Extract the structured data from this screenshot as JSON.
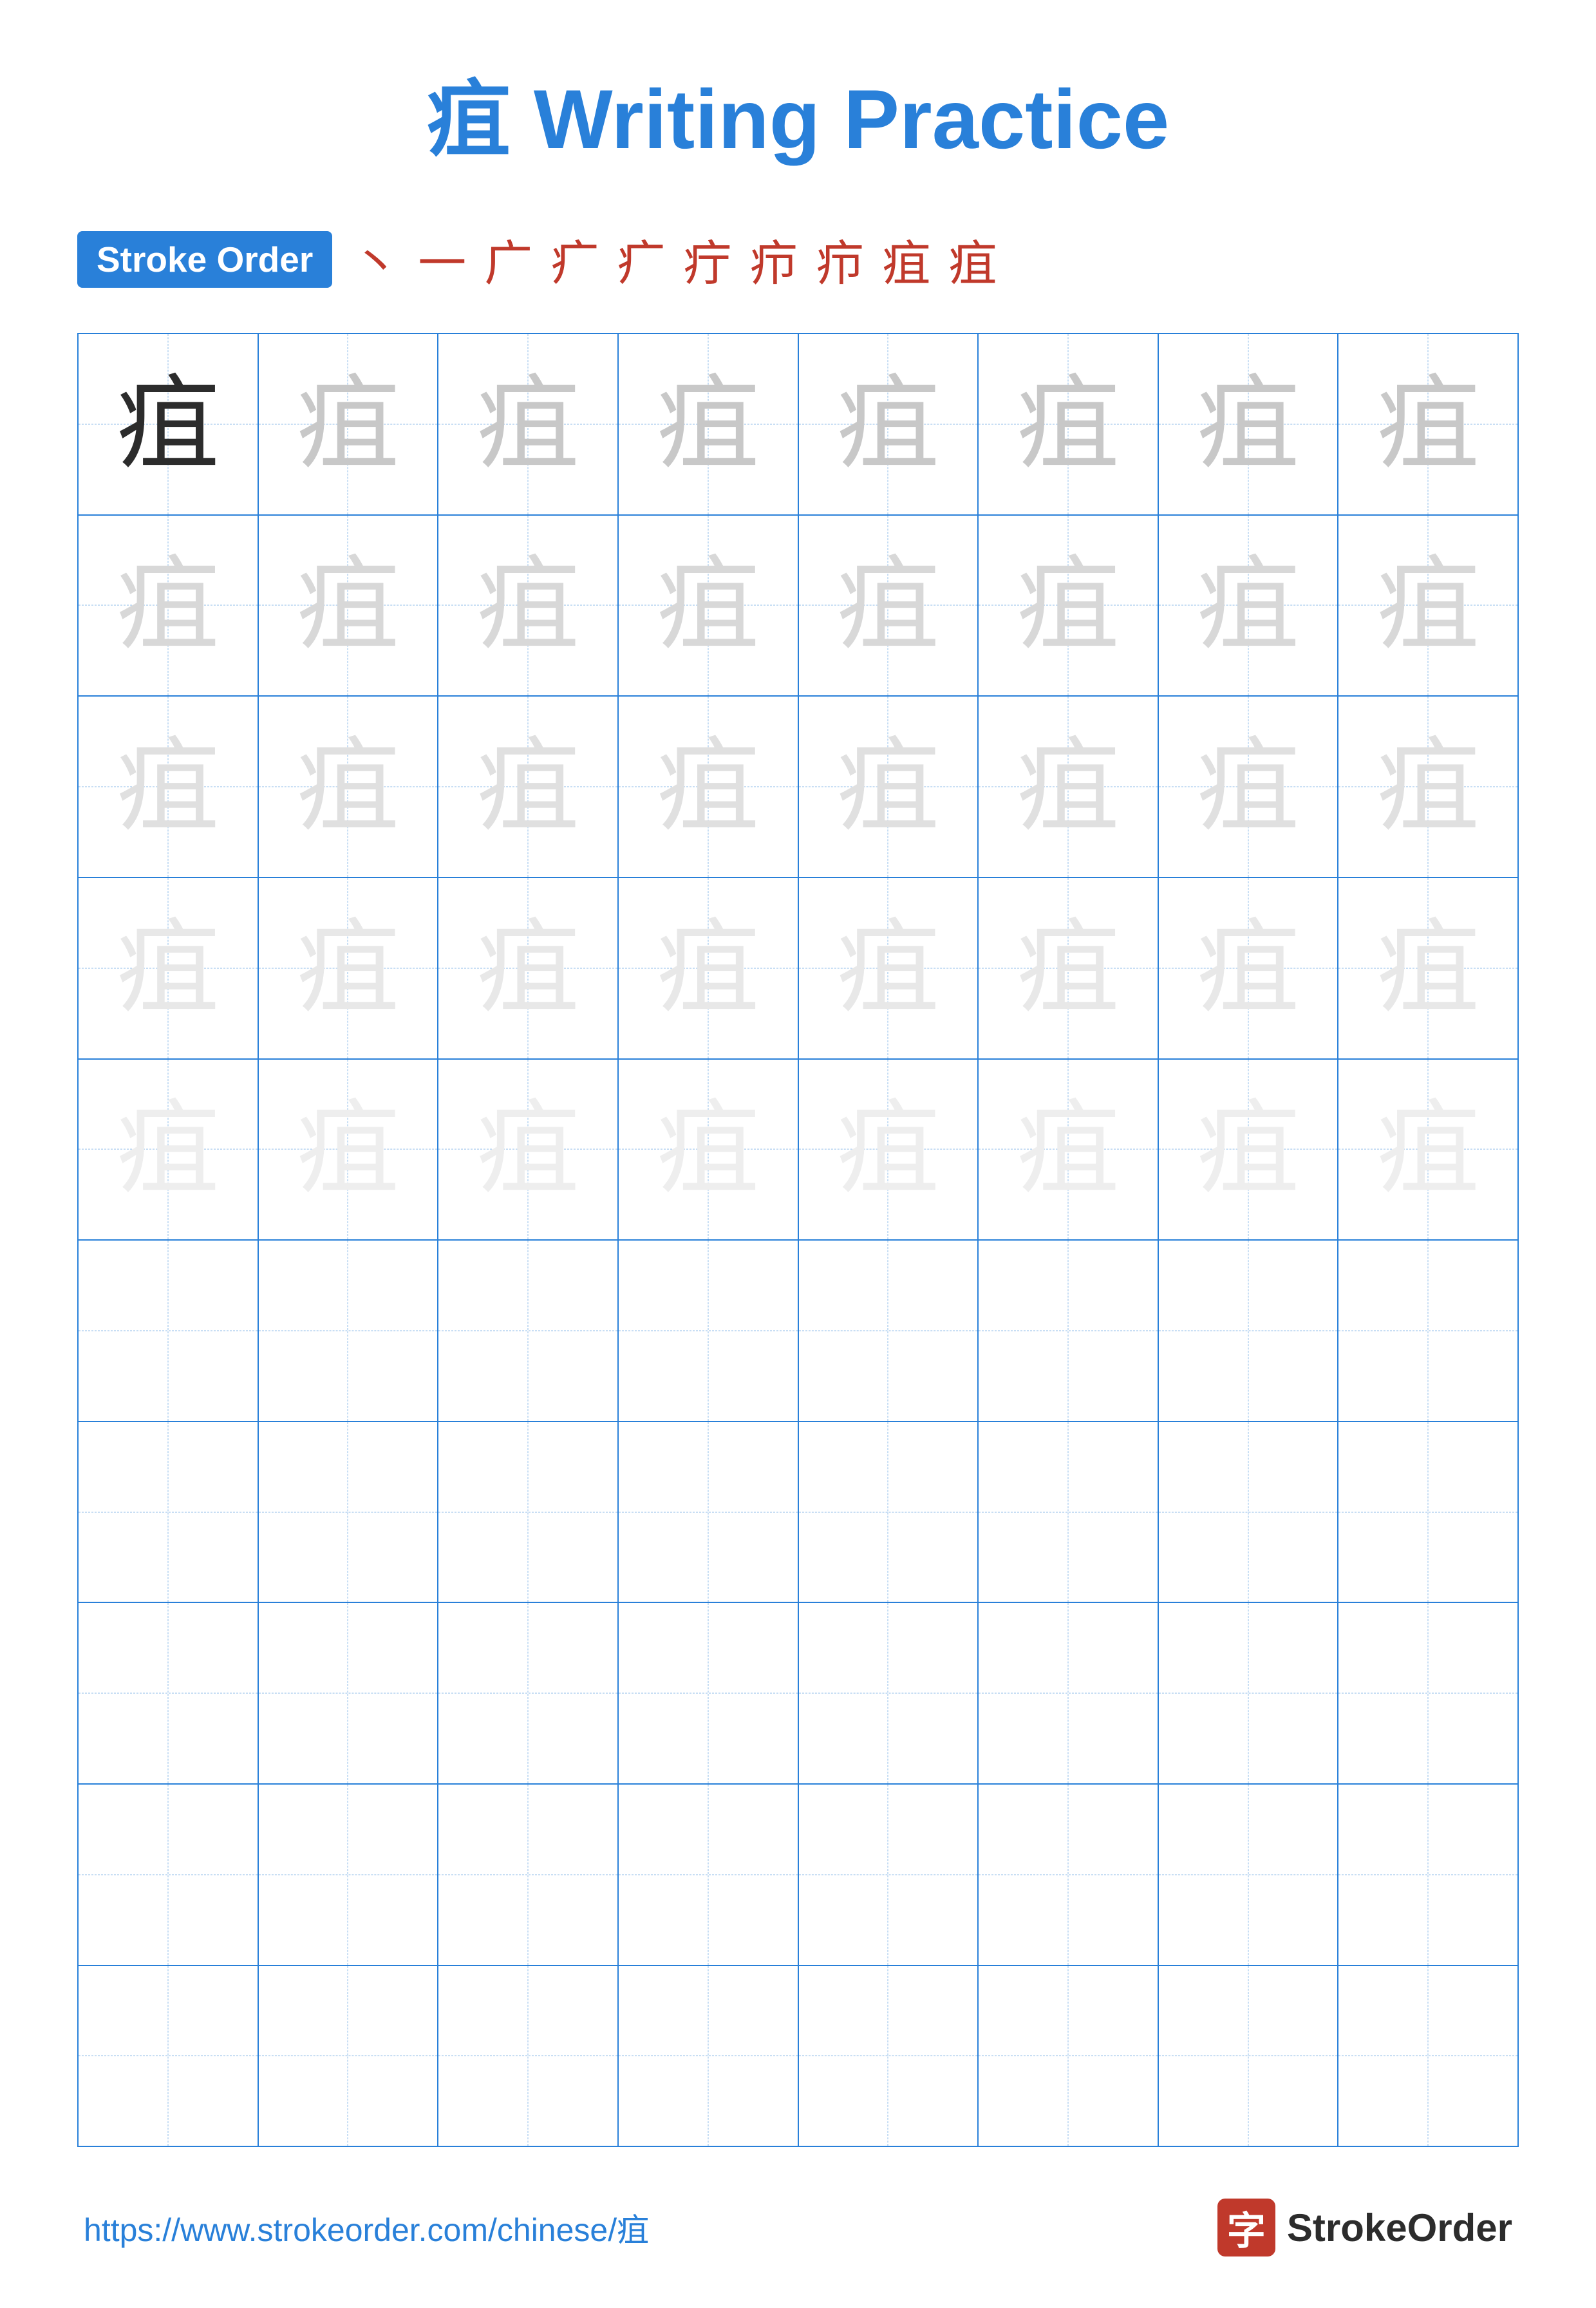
{
  "title": "疽 Writing Practice",
  "strokeOrder": {
    "badge": "Stroke Order",
    "chars": [
      "丶",
      "一",
      "广",
      "疒",
      "疒",
      "疔",
      "疖",
      "疖",
      "疽",
      "疽"
    ]
  },
  "character": "疽",
  "grid": {
    "rows": 10,
    "cols": 8,
    "traceRows": 5,
    "emptyRows": 5
  },
  "footer": {
    "url": "https://www.strokeorder.com/chinese/疽",
    "brandIcon": "字",
    "brandText": "StrokeOrder"
  }
}
